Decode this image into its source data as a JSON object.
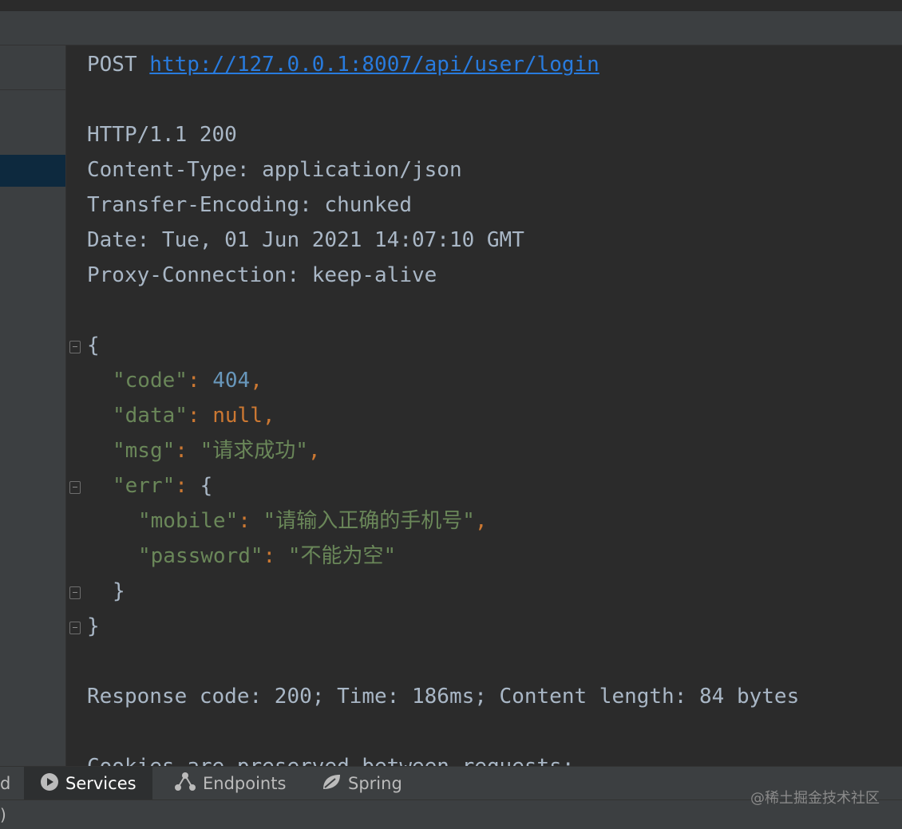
{
  "request": {
    "method": "POST",
    "url": "http://127.0.0.1:8007/api/user/login"
  },
  "headers": [
    "HTTP/1.1 200",
    "Content-Type: application/json",
    "Transfer-Encoding: chunked",
    "Date: Tue, 01 Jun 2021 14:07:10 GMT",
    "Proxy-Connection: keep-alive"
  ],
  "json": {
    "code_key": "\"code\"",
    "code_val": "404",
    "data_key": "\"data\"",
    "data_val": "null",
    "msg_key": "\"msg\"",
    "msg_val": "\"请求成功\"",
    "err_key": "\"err\"",
    "mobile_key": "\"mobile\"",
    "mobile_val": "\"请输入正确的手机号\"",
    "password_key": "\"password\"",
    "password_val": "\"不能为空\""
  },
  "summary": "Response code: 200; Time: 186ms; Content length: 84 bytes",
  "cookies_line": "Cookies are preserved between requests:",
  "tabs": {
    "left_partial": "d",
    "services": "Services",
    "endpoints": "Endpoints",
    "spring": "Spring"
  },
  "bottom_partial": ")",
  "watermark": "@稀土掘金技术社区",
  "colors": {
    "background": "#2b2b2b",
    "panel": "#3c3f41",
    "url": "#287bde",
    "string": "#6a8759",
    "number": "#6897bb",
    "keyword": "#cc7832"
  }
}
